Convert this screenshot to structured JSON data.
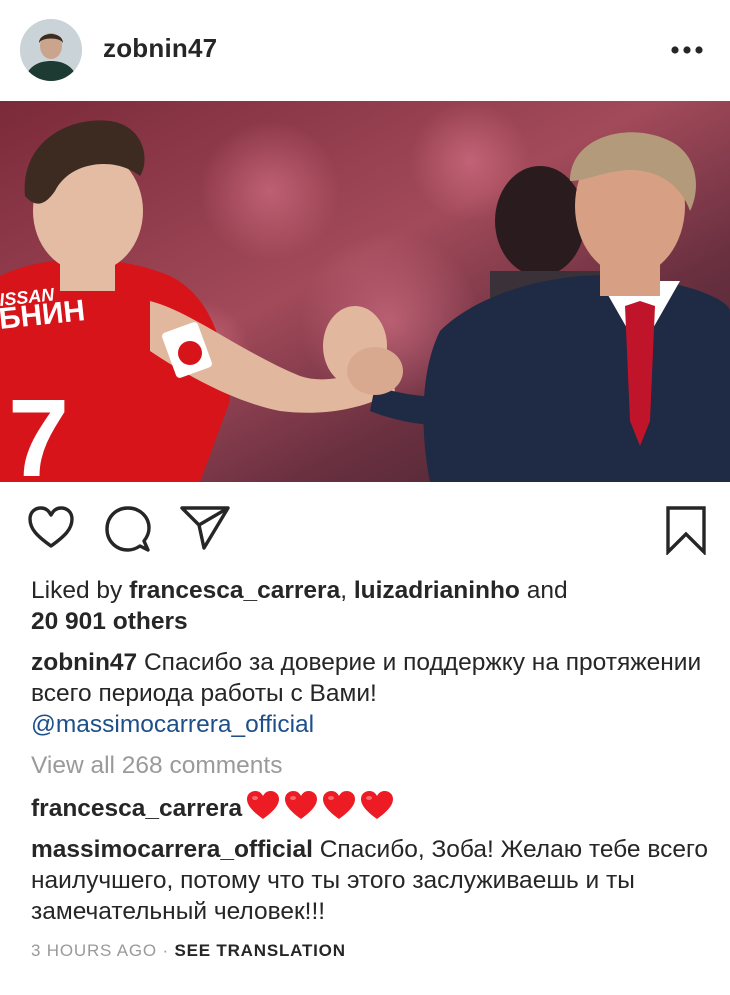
{
  "post": {
    "username": "zobnin47",
    "more_icon": "more-horizontal-icon",
    "image_alt_hint": "two-men-handshake-photo"
  },
  "actions": {
    "like_icon": "heart-outline-icon",
    "comment_icon": "comment-bubble-icon",
    "share_icon": "paper-plane-icon",
    "save_icon": "bookmark-outline-icon"
  },
  "likes": {
    "prefix": "Liked by ",
    "user1": "francesca_carrera",
    "separator": ", ",
    "user2": "luizadrianinho",
    "and": " and",
    "others": "20 901 others"
  },
  "caption": {
    "username": "zobnin47",
    "text": " Спасибо за доверие и поддержку на протяжении всего периода работы с Вами!",
    "mention": "@massimocarrera_official"
  },
  "view_all_comments": "View all 268 comments",
  "comments": [
    {
      "username": "francesca_carrera",
      "text": "",
      "emoji": "red-heart-icon",
      "emoji_count": 4
    },
    {
      "username": "massimocarrera_official",
      "text": " Спасибо, Зоба! Желаю тебе всего наилучшего, потому что ты этого заслуживаешь и ты замечательный человек!!!"
    }
  ],
  "timestamp": "3 HOURS AGO",
  "dot": " · ",
  "see_translation": "SEE TRANSLATION",
  "colors": {
    "text": "#262626",
    "muted": "#9a9a9a",
    "mention": "#1e4f8a",
    "heart_red": "#ed1c24",
    "jersey_red": "#d7141a"
  }
}
